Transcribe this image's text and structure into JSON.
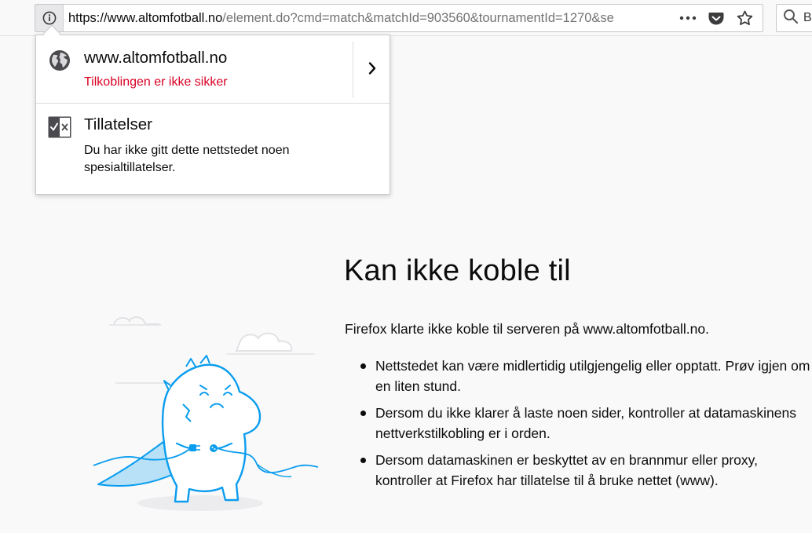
{
  "urlbar": {
    "url_host": "https://www.altomfotball.no",
    "url_path": "/element.do?cmd=match&matchId=903560&tournamentId=1270&se"
  },
  "searchbar": {
    "text": "B"
  },
  "identity_popup": {
    "host": "www.altomfotball.no",
    "connection_status": "Tilkoblingen er ikke sikker",
    "permissions_title": "Tillatelser",
    "permissions_description": "Du har ikke gitt dette nettstedet noen spesialtillatelser."
  },
  "error_page": {
    "title": "Kan ikke koble til",
    "intro": "Firefox klarte ikke koble til serveren på www.altomfotball.no.",
    "items": [
      "Nettstedet kan være midlertidig utilgjengelig eller opptatt. Prøv igjen om en liten stund.",
      "Dersom du ikke klarer å laste noen sider, kontroller at datamaskinens nettverkstilkobling er i orden.",
      "Dersom datamaskinen er beskyttet av en brannmur eller proxy, kontroller at Firefox har tillatelse til å bruke nettet (www)."
    ]
  },
  "icons": {
    "identity": "info-icon",
    "page_actions": "more-actions-icon",
    "pocket": "pocket-icon",
    "bookmark": "star-icon",
    "search": "search-icon",
    "site": "globe-icon",
    "permissions": "permissions-icon",
    "expand": "chevron-right-icon"
  },
  "colors": {
    "insecure": "#d70022",
    "illustration": "#0a9dee"
  }
}
